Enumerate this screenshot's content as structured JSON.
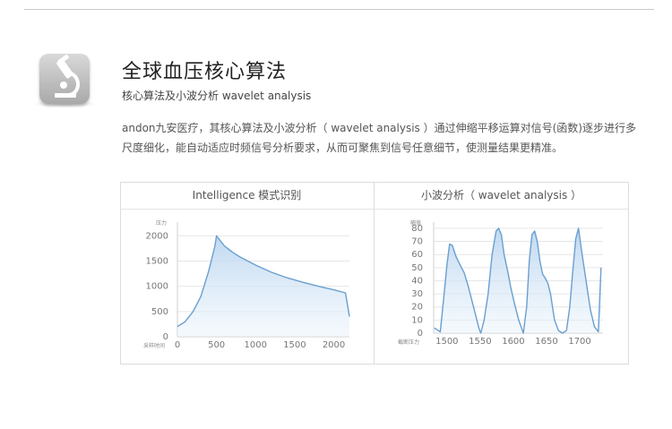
{
  "header": {
    "title": "全球血压核心算法",
    "subtitle": "核心算法及小波分析 wavelet analysis",
    "description": "andon九安医疗，其核心算法及小波分析（ wavelet analysis ）通过伸缩平移运算对信号(函数)逐步进行多尺度细化，能自动适应时频信号分析要求，从而可聚焦到信号任意细节，使测量结果更精准。",
    "icon": "microscope-icon"
  },
  "chart_data": [
    {
      "type": "area",
      "title": "Intelligence 模式识别",
      "ylabel": "压力",
      "xlabel": "采样时间",
      "xlim": [
        0,
        2200
      ],
      "ylim": [
        0,
        2200
      ],
      "xticks": [
        "0",
        "500",
        "1000",
        "1500",
        "2000"
      ],
      "yticks": [
        "0",
        "500",
        "1000",
        "1500",
        "2000"
      ],
      "x": [
        0,
        100,
        200,
        300,
        400,
        480,
        500,
        600,
        700,
        800,
        1000,
        1200,
        1400,
        1600,
        1800,
        2000,
        2150,
        2200
      ],
      "y": [
        200,
        300,
        500,
        800,
        1300,
        1800,
        2000,
        1800,
        1680,
        1580,
        1420,
        1280,
        1170,
        1080,
        1000,
        930,
        870,
        400
      ],
      "grid": true,
      "color": "#6a9fd0"
    },
    {
      "type": "area",
      "title": "小波分析（ wavelet analysis ）",
      "ylabel": "幅值",
      "xlabel": "截断压力",
      "xlim": [
        1480,
        1735
      ],
      "ylim": [
        0,
        82
      ],
      "xticks": [
        "1500",
        "1550",
        "1600",
        "1650",
        "1700"
      ],
      "yticks": [
        "0",
        "10",
        "20",
        "30",
        "40",
        "50",
        "60",
        "70",
        "80"
      ],
      "x": [
        1481,
        1487,
        1490,
        1495,
        1500,
        1504,
        1508,
        1514,
        1520,
        1526,
        1532,
        1540,
        1548,
        1551,
        1556,
        1562,
        1568,
        1574,
        1578,
        1582,
        1586,
        1592,
        1596,
        1602,
        1608,
        1615,
        1620,
        1624,
        1628,
        1632,
        1636,
        1640,
        1644,
        1648,
        1652,
        1656,
        1662,
        1668,
        1674,
        1680,
        1685,
        1690,
        1694,
        1698,
        1703,
        1710,
        1716,
        1722,
        1728,
        1732
      ],
      "y": [
        4,
        2,
        1,
        26,
        52,
        68,
        67,
        58,
        52,
        46,
        36,
        20,
        4,
        0,
        10,
        30,
        60,
        78,
        80,
        75,
        60,
        46,
        35,
        22,
        10,
        0,
        20,
        55,
        75,
        78,
        70,
        55,
        45,
        42,
        38,
        30,
        10,
        2,
        0,
        2,
        20,
        50,
        72,
        80,
        62,
        38,
        18,
        5,
        1,
        50
      ],
      "grid": true,
      "color": "#6a9fd0"
    }
  ]
}
